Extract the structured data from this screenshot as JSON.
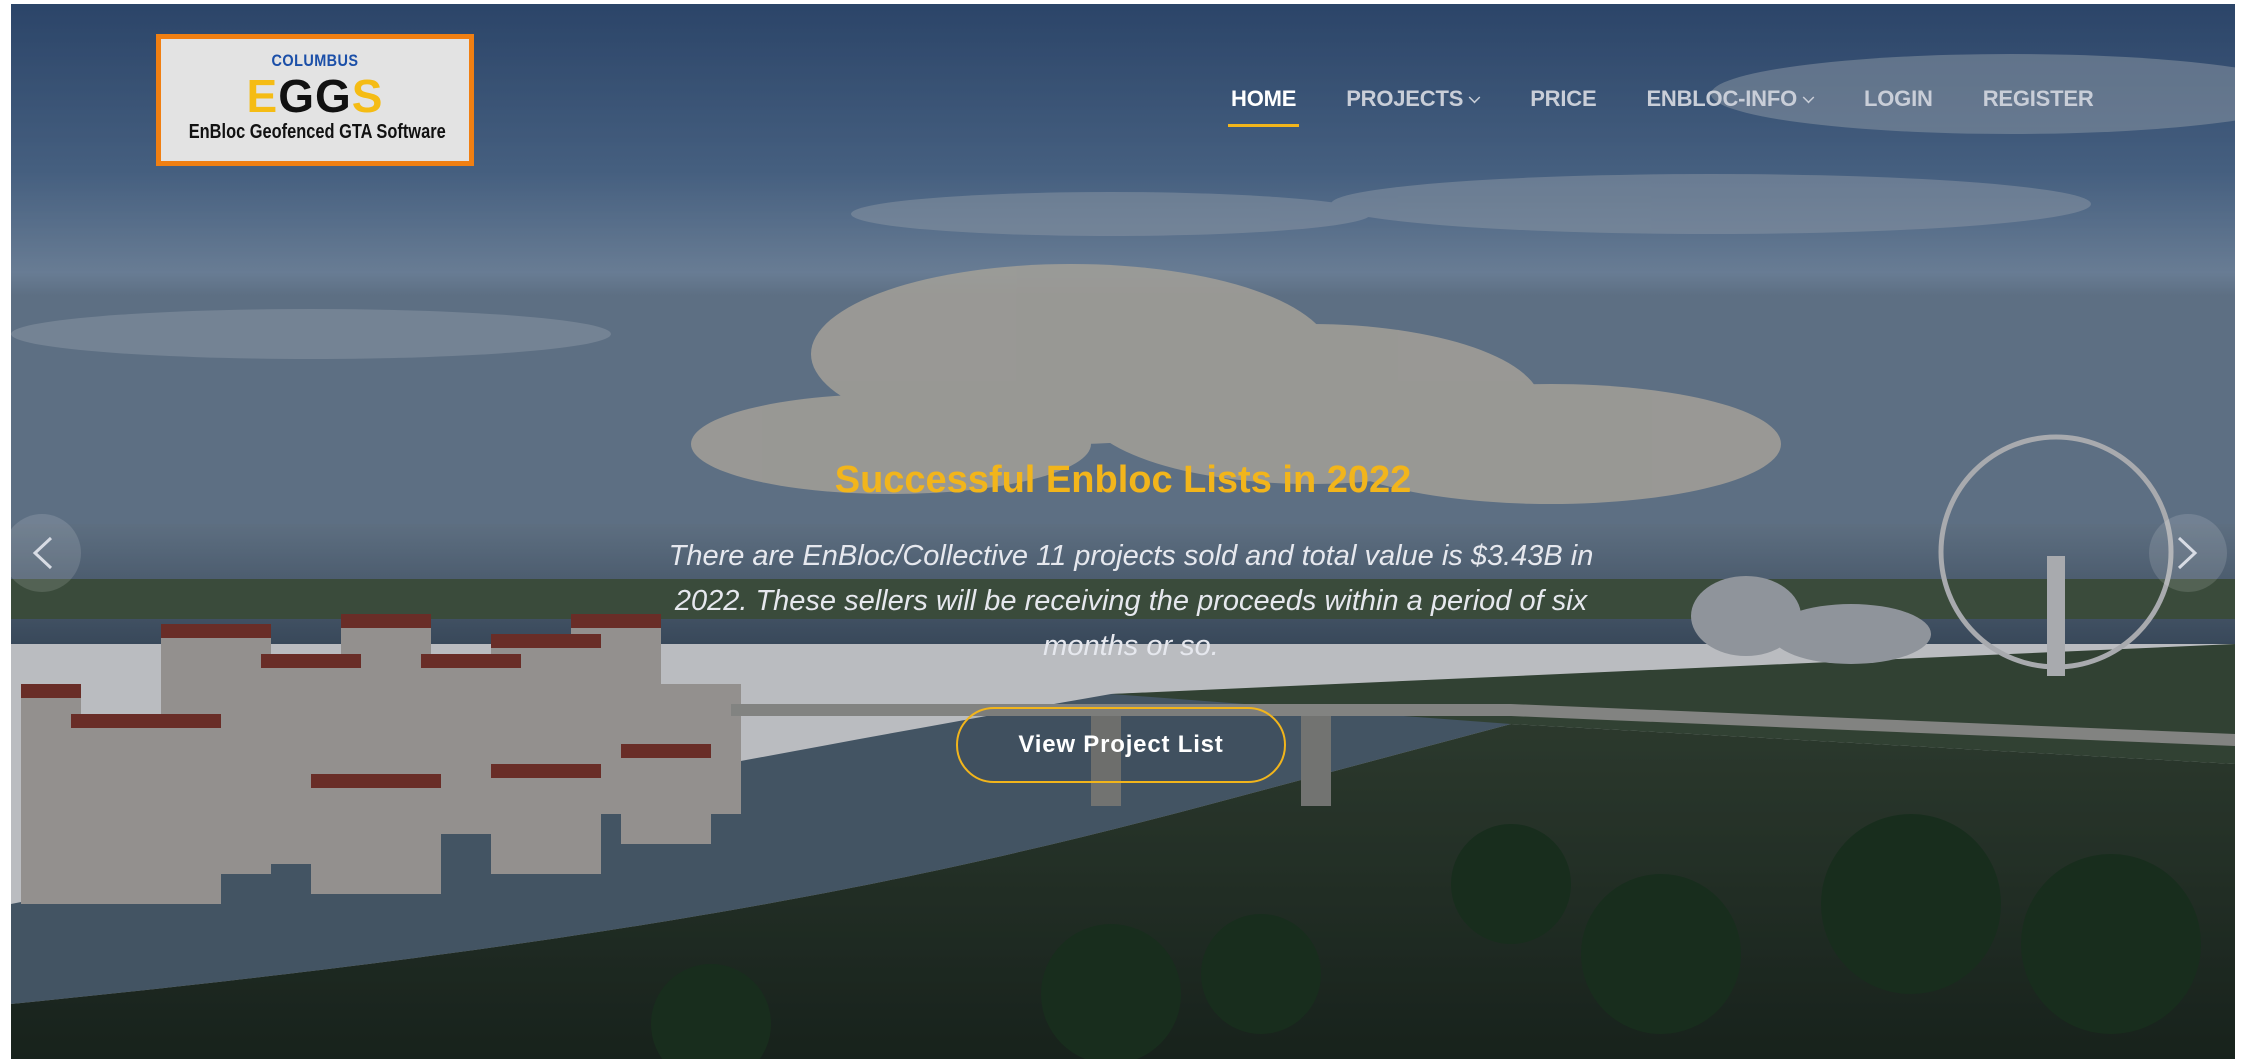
{
  "logo": {
    "line1": "COLUMBUS",
    "eggs_e": "E",
    "eggs_gg": "GG",
    "eggs_s": "S",
    "line3": "EnBloc Geofenced GTA Software"
  },
  "nav": {
    "items": [
      {
        "label": "HOME",
        "active": true
      },
      {
        "label": "PROJECTS",
        "dropdown": true
      },
      {
        "label": "PRICE"
      },
      {
        "label": "ENBLOC-INFO",
        "dropdown": true
      },
      {
        "label": "LOGIN"
      },
      {
        "label": "REGISTER"
      }
    ]
  },
  "hero": {
    "title": "Successful Enbloc Lists in 2022",
    "description": "There are EnBloc/Collective 11 projects sold and total value is $3.43B in 2022. These sellers will be receiving the proceeds within a period of six months or so.",
    "button_label": "View Project List"
  },
  "carousel": {
    "prev_icon": "chevron-left-icon",
    "next_icon": "chevron-right-icon"
  },
  "colors": {
    "accent": "#f2b51b",
    "logo_border": "#f07f12",
    "logo_blue": "#1b4fa8"
  }
}
